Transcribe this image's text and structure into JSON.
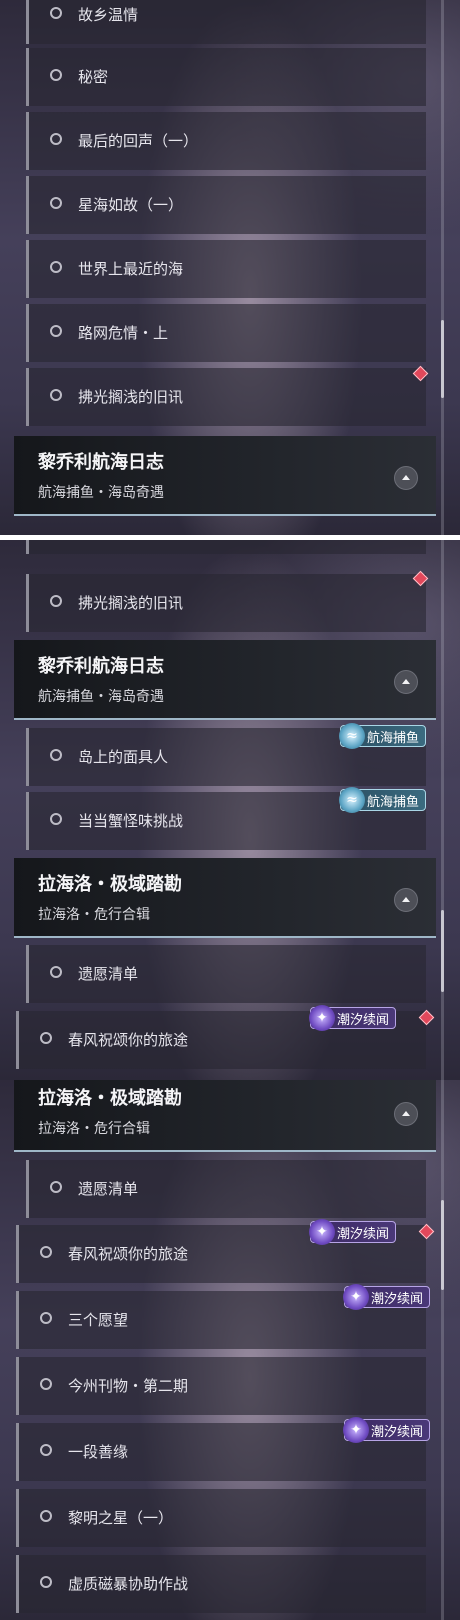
{
  "colors": {
    "accent_red": "#e2485b",
    "purple_badge": "#4a3878",
    "blue_badge": "#3b6b80",
    "header_bg": "#1c1e23"
  },
  "icons": {
    "list_marker": "circle-icon",
    "collapse": "chevron-up-icon",
    "purple_badge": "sparkle-wave-icon",
    "blue_badge": "wave-icon",
    "alert": "red-diamond-icon"
  },
  "panel1": {
    "items": [
      "故乡温情",
      "秘密",
      "最后的回声（一）",
      "星海如故（一）",
      "世界上最近的海",
      "路网危情・上",
      "拂光搁浅的旧讯"
    ],
    "header": {
      "title": "黎乔利航海日志",
      "subtitle": "航海捕鱼・海岛奇遇"
    }
  },
  "panel2": {
    "items_top": [
      "拂光搁浅的旧讯"
    ],
    "header1": {
      "title": "黎乔利航海日志",
      "subtitle": "航海捕鱼・海岛奇遇"
    },
    "items_mid": [
      "岛上的面具人",
      "当当蟹怪味挑战"
    ],
    "badges_mid": [
      "航海捕鱼",
      "航海捕鱼"
    ],
    "header2": {
      "title": "拉海洛・极域踏勘",
      "subtitle": "拉海洛・危行合辑"
    },
    "items_bottom": [
      "遗愿清单",
      "春风祝颂你的旅途"
    ],
    "badge_bottom": "潮汐续闻"
  },
  "panel3": {
    "header": {
      "title": "拉海洛・极域踏勘",
      "subtitle": "拉海洛・危行合辑"
    },
    "items": [
      "遗愿清单",
      "春风祝颂你的旅途",
      "三个愿望",
      "今州刊物・第二期",
      "一段善缘",
      "黎明之星（一）",
      "虚质磁暴协助作战"
    ],
    "badges": [
      "潮汐续闻",
      "潮汐续闻",
      "潮汐续闻"
    ]
  }
}
